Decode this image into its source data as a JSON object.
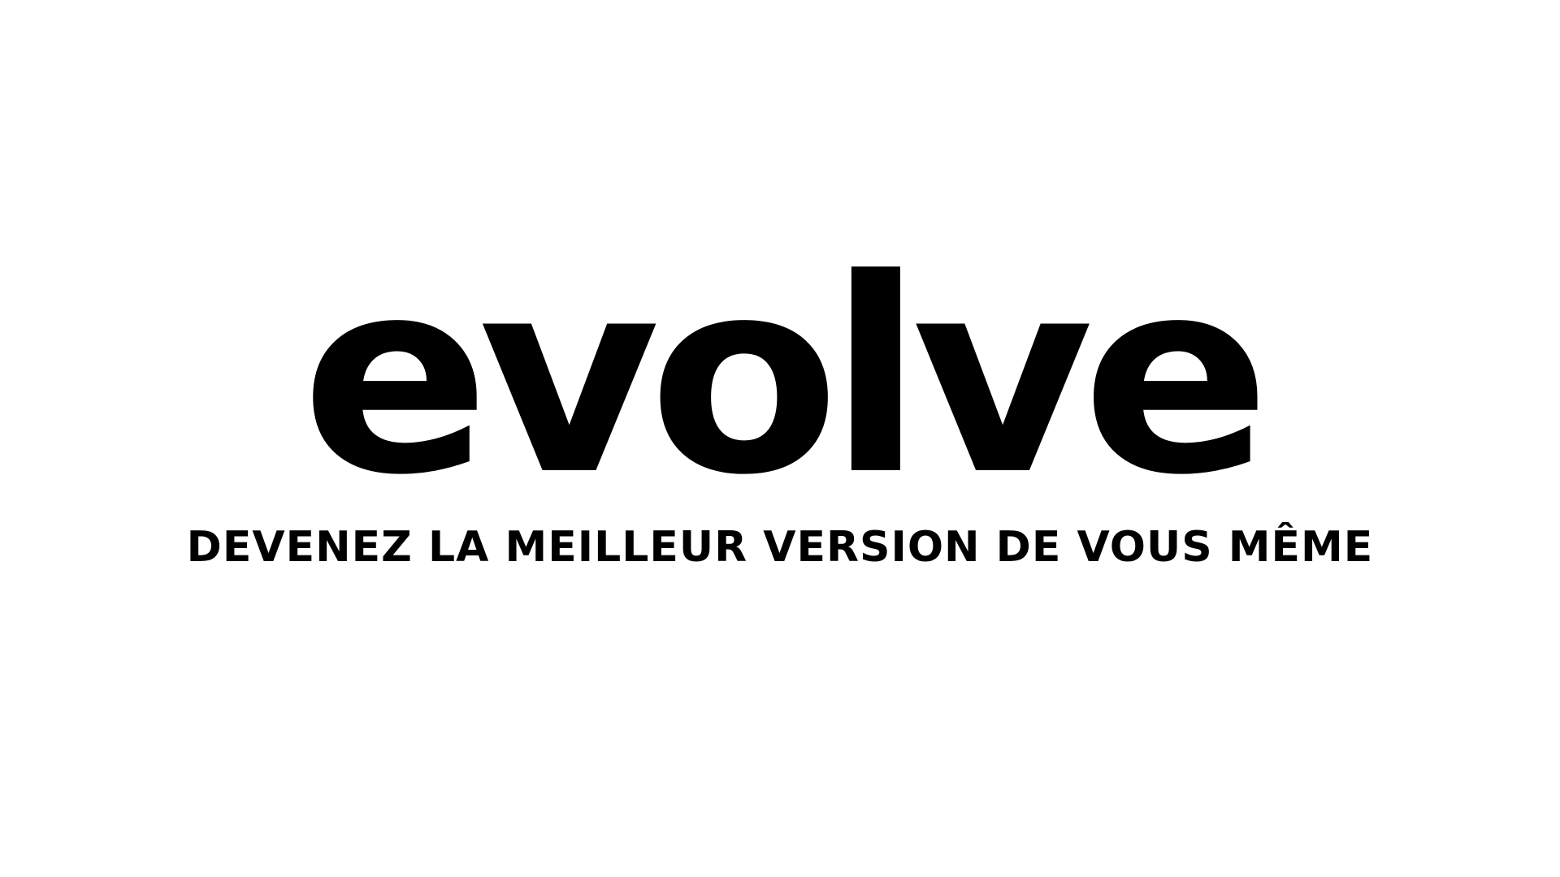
{
  "brand": {
    "wordmark": "evolve",
    "tagline": "DEVENEZ LA MEILLEUR VERSION DE VOUS MÊME"
  },
  "colors": {
    "background": "#ffffff",
    "text": "#000000"
  }
}
